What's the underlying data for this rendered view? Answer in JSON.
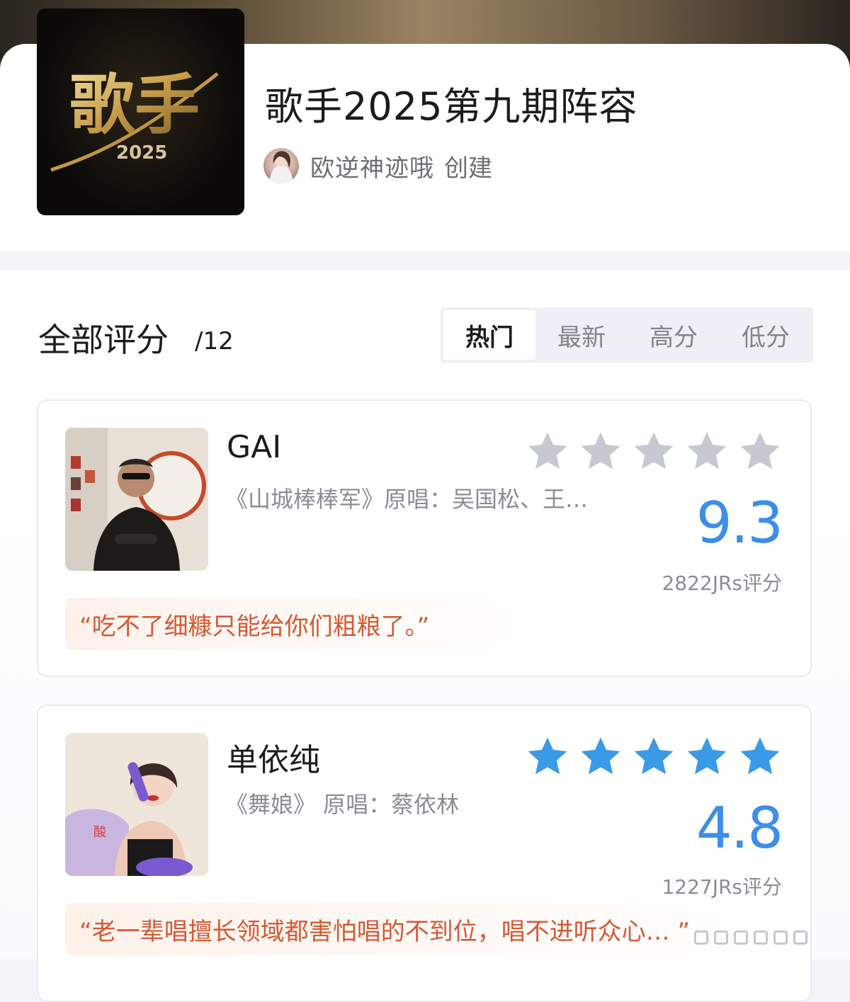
{
  "header": {
    "cover_alt": "歌手 2025",
    "cover_logo_text": "歌手",
    "cover_year": "2025",
    "title": "歌手2025第九期阵容",
    "creator_name": "欧逆神迹哦",
    "creator_suffix": "创建"
  },
  "section": {
    "title": "全部评分",
    "count": "/12"
  },
  "tabs": [
    {
      "label": "热门",
      "active": true
    },
    {
      "label": "最新",
      "active": false
    },
    {
      "label": "高分",
      "active": false
    },
    {
      "label": "低分",
      "active": false
    }
  ],
  "ratings": [
    {
      "name": "GAI",
      "song": "《山城棒棒军》原唱：吴国松、王…",
      "score": "9.3",
      "stars_filled": 0,
      "stars_total": 5,
      "raters": "2822JRs评分",
      "quote": "“吃不了细糠只能给你们粗粮了。”"
    },
    {
      "name": "单依纯",
      "song": "《舞娘》 原唱：蔡依林",
      "score": "4.8",
      "stars_filled": 5,
      "stars_total": 5,
      "raters": "1227JRs评分",
      "quote": "“老一辈唱擅长领域都害怕唱的不到位，唱不进听众心… ”"
    }
  ],
  "colors": {
    "accent": "#3c8ee8",
    "star_filled": "#3a9ae8",
    "star_empty": "#c6c9d2",
    "quote_text": "#d45a36"
  }
}
